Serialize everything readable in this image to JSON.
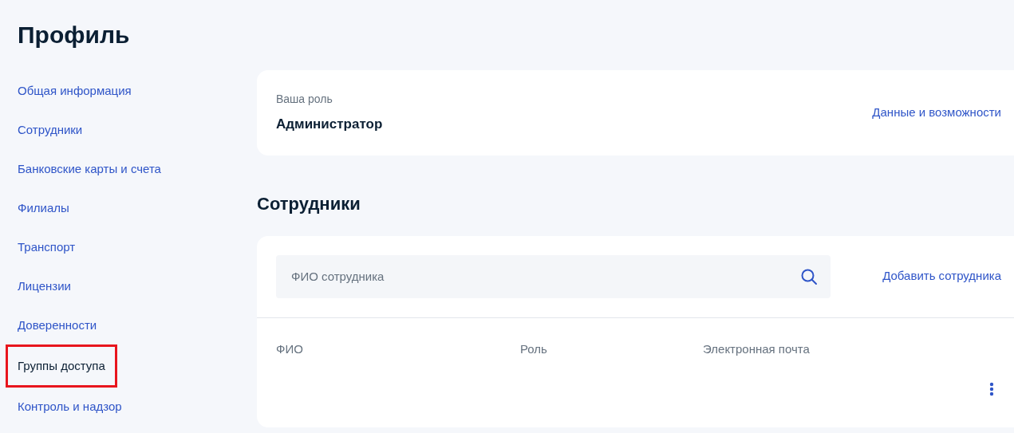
{
  "page_title": "Профиль",
  "sidebar": {
    "items": [
      {
        "label": "Общая информация",
        "selected": false,
        "highlighted": false
      },
      {
        "label": "Сотрудники",
        "selected": false,
        "highlighted": false
      },
      {
        "label": "Банковские карты и счета",
        "selected": false,
        "highlighted": false
      },
      {
        "label": "Филиалы",
        "selected": false,
        "highlighted": false
      },
      {
        "label": "Транспорт",
        "selected": false,
        "highlighted": false
      },
      {
        "label": "Лицензии",
        "selected": false,
        "highlighted": false
      },
      {
        "label": "Доверенности",
        "selected": false,
        "highlighted": false
      },
      {
        "label": "Группы доступа",
        "selected": true,
        "highlighted": true
      },
      {
        "label": "Контроль и надзор",
        "selected": false,
        "highlighted": false
      }
    ]
  },
  "role_card": {
    "caption": "Ваша роль",
    "role": "Администратор",
    "link": "Данные и возможности"
  },
  "employees": {
    "heading": "Сотрудники",
    "search": {
      "placeholder": "ФИО сотрудника"
    },
    "add_link": "Добавить сотрудника",
    "table": {
      "columns": [
        "ФИО",
        "Роль",
        "Электронная почта"
      ]
    }
  }
}
